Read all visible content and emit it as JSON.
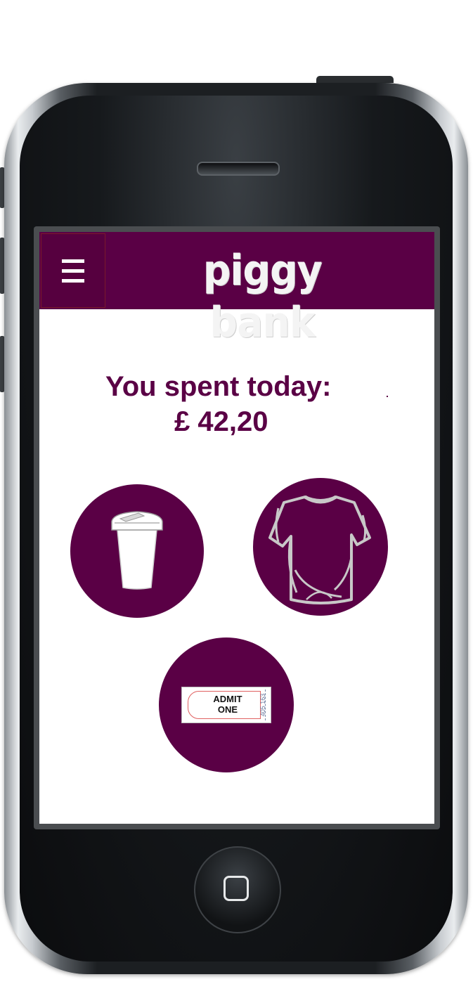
{
  "app": {
    "title": "piggy bank"
  },
  "summary": {
    "label": "You spent today:",
    "amount": "£ 42,20"
  },
  "categories": [
    {
      "name": "coffee",
      "icon": "coffee-cup-icon"
    },
    {
      "name": "clothes",
      "icon": "t-shirt-icon"
    },
    {
      "name": "tickets",
      "icon": "ticket-icon",
      "ticket_text": "ADMIT ONE",
      "ticket_number": "405 163"
    }
  ],
  "colors": {
    "brand": "#5a0045",
    "header_text": "#f4f4f4",
    "background": "#ffffff"
  },
  "icons": {
    "menu": "hamburger-menu-icon",
    "home": "home-button-icon"
  }
}
